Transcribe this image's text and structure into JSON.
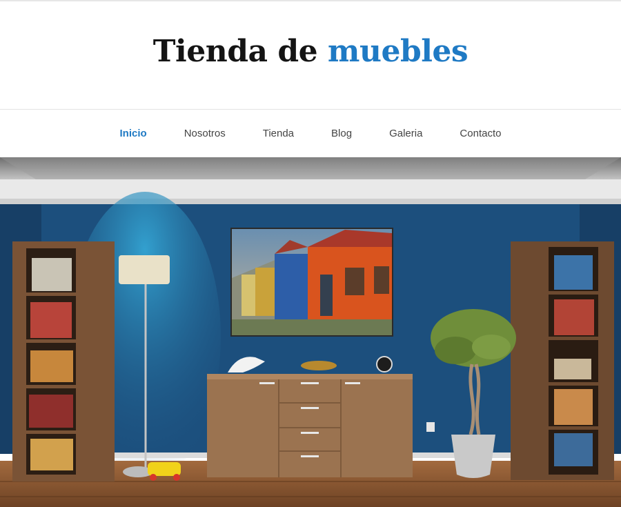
{
  "site": {
    "title_main": "Tienda de",
    "title_accent": "muebles",
    "accent_color": "#1f7ac4"
  },
  "nav": {
    "items": [
      {
        "label": "Inicio",
        "active": true
      },
      {
        "label": "Nosotros",
        "active": false
      },
      {
        "label": "Tienda",
        "active": false
      },
      {
        "label": "Blog",
        "active": false
      },
      {
        "label": "Galeria",
        "active": false
      },
      {
        "label": "Contacto",
        "active": false
      }
    ]
  },
  "hero": {
    "image_subject": "living-room-interior",
    "wall_color": "#1c4f7d",
    "floor_color": "#8a5a35",
    "furniture_color": "#9b7350"
  }
}
